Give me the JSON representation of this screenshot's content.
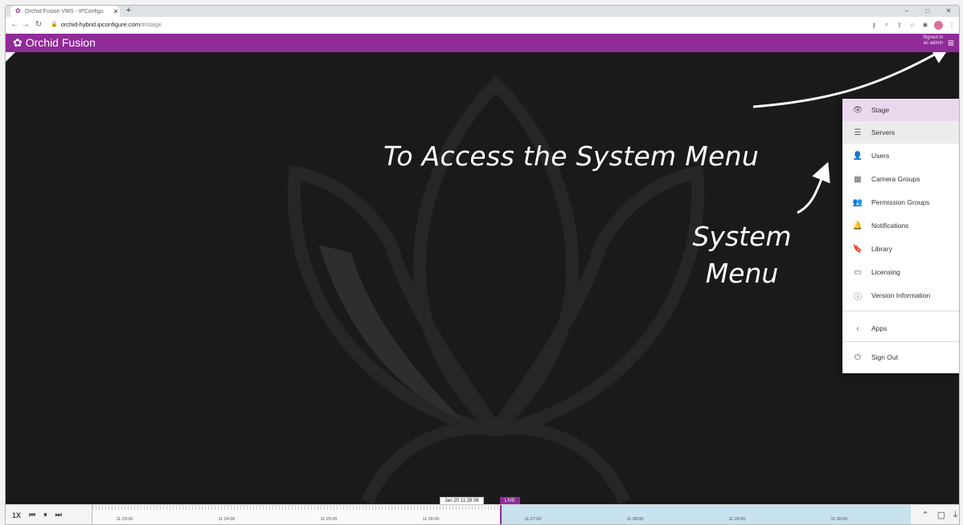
{
  "browser": {
    "tab_title": "Orchid Fusion VMS - IPConfigu",
    "tab_close": "✕",
    "new_tab": "+",
    "url_host": "orchid-hybrid.ipconfigure.com",
    "url_path": "/#/stage",
    "window_controls": [
      "–",
      "□",
      "✕"
    ]
  },
  "app": {
    "title": "Orchid Fusion",
    "signed_in_line1": "Signed in",
    "signed_in_line2": "as admin"
  },
  "annotations": {
    "access": "To Access the System Menu",
    "system_line1": "System",
    "system_line2": "Menu"
  },
  "menu": {
    "items": [
      {
        "label": "Stage",
        "icon": "eye-icon"
      },
      {
        "label": "Servers",
        "icon": "server-list-icon"
      },
      {
        "label": "Users",
        "icon": "user-icon"
      },
      {
        "label": "Camera Groups",
        "icon": "camera-group-icon"
      },
      {
        "label": "Permission Groups",
        "icon": "people-icon"
      },
      {
        "label": "Notifications",
        "icon": "bell-icon"
      },
      {
        "label": "Library",
        "icon": "bookmark-icon"
      },
      {
        "label": "Licensing",
        "icon": "license-card-icon"
      },
      {
        "label": "Version Information",
        "icon": "info-icon"
      },
      {
        "label": "Apps",
        "icon": "chevron-left-icon"
      },
      {
        "label": "Sign Out",
        "icon": "power-icon"
      }
    ]
  },
  "timeline": {
    "speed": "1X",
    "current_time": "Jan 20 11:28:36",
    "live_label": "LIVE",
    "ticks": [
      "11:23:00",
      "11:24:00",
      "11:25:00",
      "11:26:00",
      "11:27:00",
      "11:28:00",
      "11:29:00",
      "11:30:00"
    ]
  },
  "colors": {
    "brand": "#8f2b98",
    "stage_bg": "#1a1a1a",
    "future_range": "#c8e2ef"
  }
}
